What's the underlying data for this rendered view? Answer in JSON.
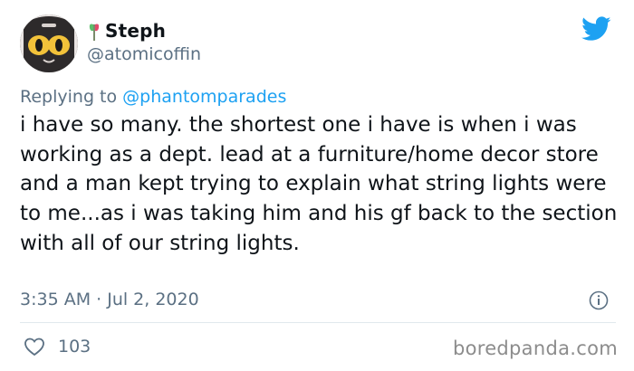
{
  "author": {
    "display_name": "Steph",
    "handle": "@atomicoffin"
  },
  "reply": {
    "prefix": "Replying to",
    "handle": "@phantomparades"
  },
  "tweet": {
    "text": "i have so many. the shortest one i have is when i was working as a dept. lead at a furniture/home decor store and a man kept trying to explain what string lights were to me...as i was taking him and his gf back to the section with all of our string lights.",
    "timestamp": "3:35 AM · Jul 2, 2020",
    "likes": "103"
  },
  "watermark": "boredpanda.com",
  "icons": {
    "logo": "twitter-bird-icon",
    "info": "info-icon",
    "like": "heart-icon",
    "emoji": "trans-flag-emoji"
  },
  "colors": {
    "accent": "#1da1f2",
    "muted": "#5b7083",
    "text": "#0f1419",
    "divider": "#e1e8ed"
  }
}
